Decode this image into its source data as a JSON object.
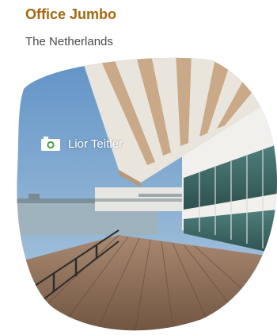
{
  "card": {
    "title": "Office Jumbo",
    "location": "The Netherlands"
  },
  "photo": {
    "credit_icon": "camera-icon",
    "credit": "Lior Teitler"
  },
  "colors": {
    "title": "#a4680f",
    "subtitle": "#4a4a4a",
    "camera_lens": "#43a047",
    "credit_text": "#ffffff"
  }
}
